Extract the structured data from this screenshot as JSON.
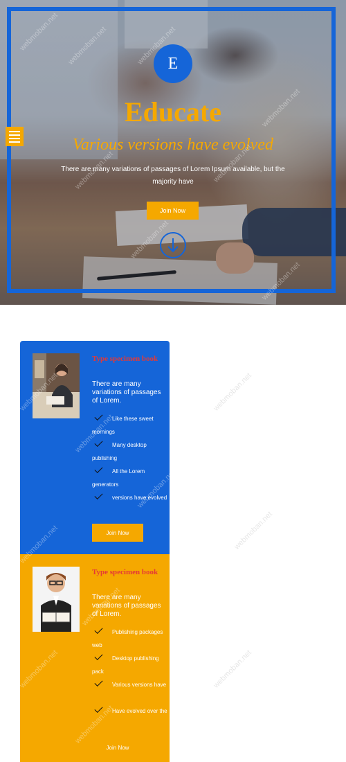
{
  "hero": {
    "logo_letter": "E",
    "title": "Educate",
    "subtitle": "Various versions have evolved",
    "text": "There are many variations of passages of Lorem Ipsum available, but the majority have",
    "button_label": "Join Now"
  },
  "cards": [
    {
      "title": "Type specimen book",
      "text": "There are many variations of passages of Lorem.",
      "items": [
        "Like these sweet mornings",
        "Many desktop publishing",
        "All the Lorem generators",
        "versions have evolved"
      ],
      "button_label": "Join Now"
    },
    {
      "title": "Type specimen book",
      "text": "There are many variations of passages of Lorem.",
      "items": [
        "Publishing packages web",
        "Desktop publishing pack",
        "Various versions have",
        "Have evolved over the"
      ],
      "button_label": "Join Now"
    }
  ],
  "watermark": "webmoban.net",
  "colors": {
    "blue": "#1565d8",
    "yellow": "#f5a800",
    "title_red": "#e53935"
  }
}
